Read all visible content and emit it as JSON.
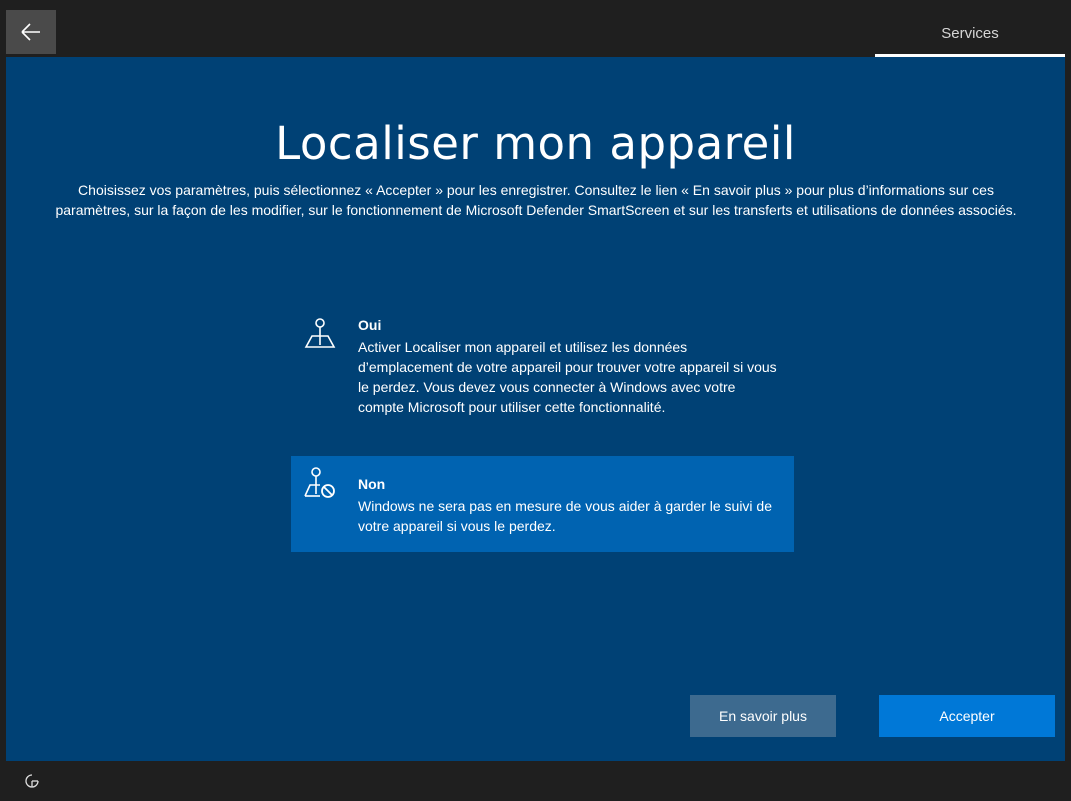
{
  "header": {
    "tab_label": "Services"
  },
  "page": {
    "title": "Localiser mon appareil",
    "description": "Choisissez vos paramètres, puis sélectionnez « Accepter » pour les enregistrer. Consultez le lien « En savoir plus » pour plus d’informations sur ces paramètres, sur la façon de les modifier, sur le fonctionnement de Microsoft Defender SmartScreen et sur les transferts et utilisations de données associés."
  },
  "options": [
    {
      "title": "Oui",
      "description": "Activer Localiser mon appareil et utilisez les données d’emplacement de votre appareil pour trouver votre appareil si vous le perdez. Vous devez vous connecter à Windows avec votre compte Microsoft pour utiliser cette fonctionnalité.",
      "icon": "location-map-icon",
      "selected": false
    },
    {
      "title": "Non",
      "description": "Windows ne sera pas en mesure de vous aider à garder le suivi de votre appareil si vous le perdez.",
      "icon": "location-map-blocked-icon",
      "selected": true
    }
  ],
  "buttons": {
    "learn_more": "En savoir plus",
    "accept": "Accepter"
  },
  "colors": {
    "background": "#004175",
    "selected_option": "#0063b1",
    "accept_button": "#0078d7",
    "learn_more_button": "#3d6a8f",
    "chrome": "#1f1f1f"
  },
  "icons": {
    "back": "back-arrow-icon",
    "accessibility": "accessibility-icon"
  }
}
